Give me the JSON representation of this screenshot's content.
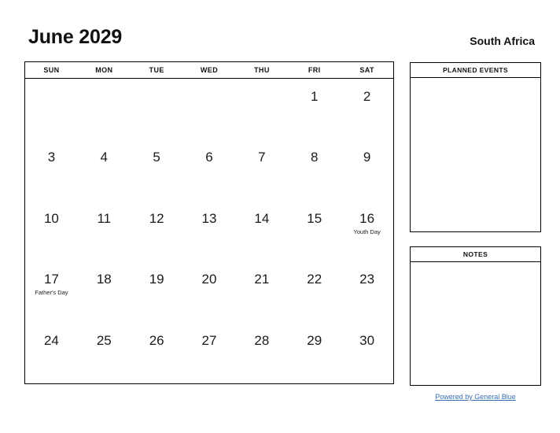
{
  "header": {
    "month_title": "June 2029",
    "country": "South Africa"
  },
  "calendar": {
    "weekdays": [
      "SUN",
      "MON",
      "TUE",
      "WED",
      "THU",
      "FRI",
      "SAT"
    ],
    "weeks": [
      [
        {
          "day": "",
          "event": ""
        },
        {
          "day": "",
          "event": ""
        },
        {
          "day": "",
          "event": ""
        },
        {
          "day": "",
          "event": ""
        },
        {
          "day": "",
          "event": ""
        },
        {
          "day": "1",
          "event": ""
        },
        {
          "day": "2",
          "event": ""
        }
      ],
      [
        {
          "day": "3",
          "event": ""
        },
        {
          "day": "4",
          "event": ""
        },
        {
          "day": "5",
          "event": ""
        },
        {
          "day": "6",
          "event": ""
        },
        {
          "day": "7",
          "event": ""
        },
        {
          "day": "8",
          "event": ""
        },
        {
          "day": "9",
          "event": ""
        }
      ],
      [
        {
          "day": "10",
          "event": ""
        },
        {
          "day": "11",
          "event": ""
        },
        {
          "day": "12",
          "event": ""
        },
        {
          "day": "13",
          "event": ""
        },
        {
          "day": "14",
          "event": ""
        },
        {
          "day": "15",
          "event": ""
        },
        {
          "day": "16",
          "event": "Youth Day"
        }
      ],
      [
        {
          "day": "17",
          "event": "Father's Day"
        },
        {
          "day": "18",
          "event": ""
        },
        {
          "day": "19",
          "event": ""
        },
        {
          "day": "20",
          "event": ""
        },
        {
          "day": "21",
          "event": ""
        },
        {
          "day": "22",
          "event": ""
        },
        {
          "day": "23",
          "event": ""
        }
      ],
      [
        {
          "day": "24",
          "event": ""
        },
        {
          "day": "25",
          "event": ""
        },
        {
          "day": "26",
          "event": ""
        },
        {
          "day": "27",
          "event": ""
        },
        {
          "day": "28",
          "event": ""
        },
        {
          "day": "29",
          "event": ""
        },
        {
          "day": "30",
          "event": ""
        }
      ]
    ]
  },
  "panels": {
    "planned_events": {
      "title": "PLANNED EVENTS",
      "content": ""
    },
    "notes": {
      "title": "NOTES",
      "content": ""
    }
  },
  "footer": {
    "link_text": "Powered by General Blue",
    "link_color": "#3b6db5"
  }
}
